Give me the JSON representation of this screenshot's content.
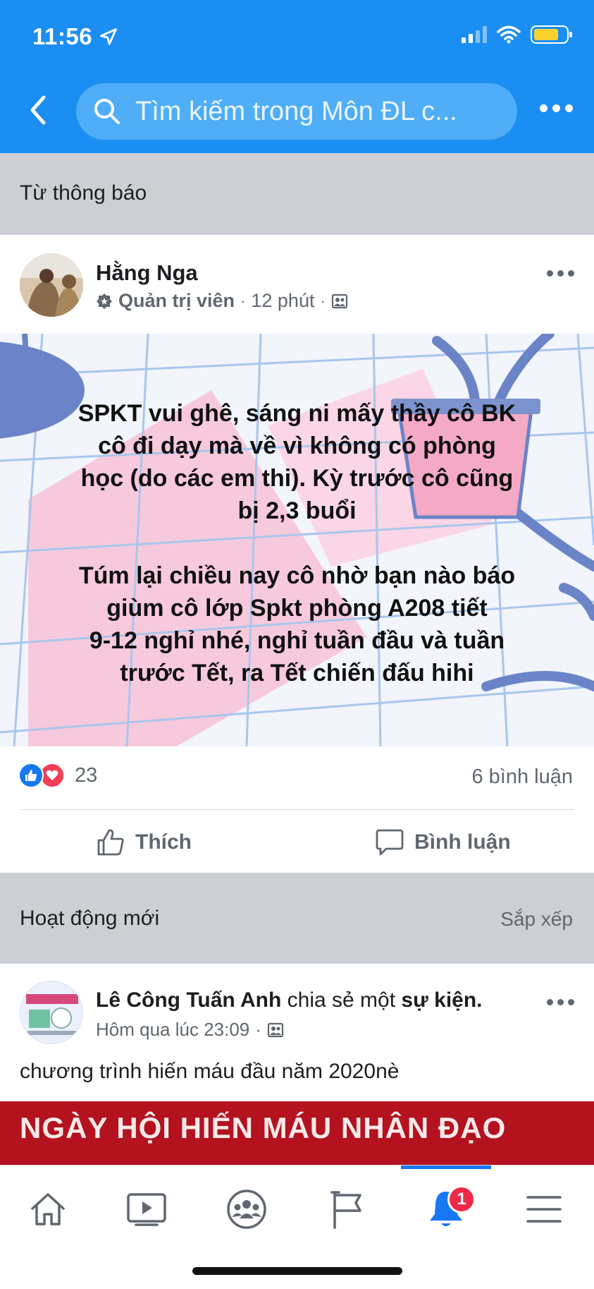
{
  "status_bar": {
    "time": "11:56"
  },
  "header": {
    "search_placeholder": "Tìm kiếm trong Môn ĐL c..."
  },
  "sections": {
    "notification_title": "Từ thông báo",
    "activity_title": "Hoạt động mới",
    "activity_sort": "Sắp xếp"
  },
  "post": {
    "author": "Hằng Nga",
    "role": "Quản trị viên",
    "time": "12 phút",
    "text_lines": [
      "SPKT vui ghê, sáng ni mấy thầy cô BK",
      "cô đi dạy mà về vì không có phòng",
      "học (do các em thi). Kỳ trước cô cũng",
      "bị 2,3 buổi",
      "Túm lại chiều nay cô nhờ bạn nào báo",
      "giùm cô lớp Spkt phòng A208 tiết",
      "9-12 nghỉ nhé, nghỉ tuần đầu và tuần",
      "trước Tết, ra Tết chiến đấu hihi"
    ],
    "reaction_count": "23",
    "comment_count": "6 bình luận",
    "like_label": "Thích",
    "comment_label": "Bình luận"
  },
  "activity": {
    "author": "Lê Công Tuấn Anh",
    "action": "chia sẻ một",
    "object": "sự kiện.",
    "time": "Hôm qua lúc 23:09",
    "text": "chương trình hiến máu đầu năm 2020nè",
    "banner_text": "NGÀY HỘI HIẾN MÁU NHÂN ĐẠO"
  },
  "bottom_nav": {
    "items": [
      "home-icon",
      "video-icon",
      "groups-icon",
      "pages-flag-icon",
      "notifications-bell-icon",
      "menu-icon"
    ],
    "active": "notifications-bell-icon",
    "notification_badge": "1"
  },
  "colors": {
    "header_blue": "#1a8ef2",
    "search_blue": "#4faef7",
    "section_gray": "#ccd0d5",
    "like_blue": "#1877f2",
    "love_red": "#f33e58",
    "banner_red": "#b3121e"
  }
}
